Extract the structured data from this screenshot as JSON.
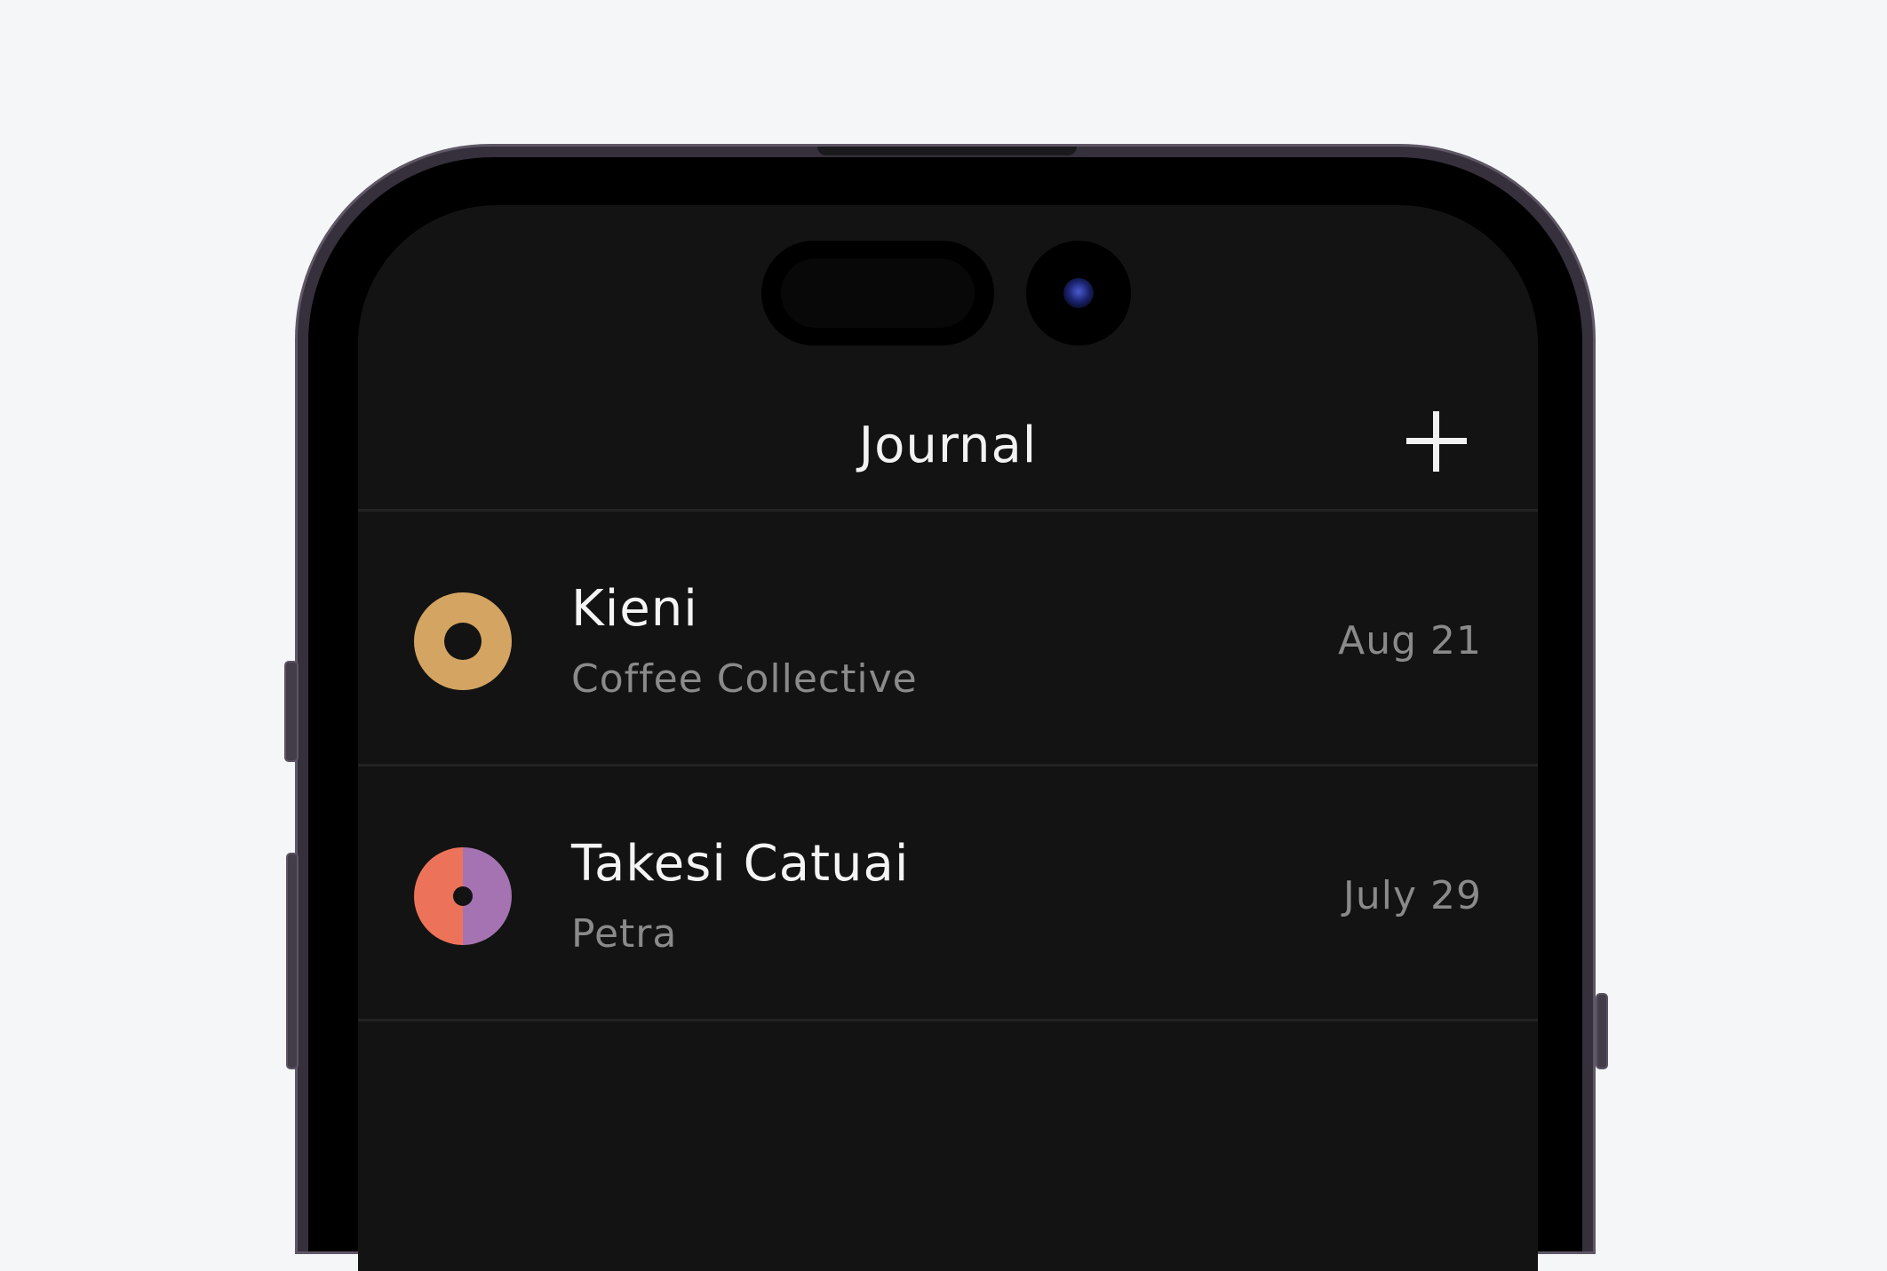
{
  "header": {
    "title": "Journal",
    "add_icon": "plus-icon"
  },
  "entries": [
    {
      "name": "Kieni",
      "subtitle": "Coffee Collective",
      "date": "Aug 21",
      "avatar_icon": "ring-avatar-icon",
      "avatar_colors": [
        "#d4a562"
      ]
    },
    {
      "name": "Takesi Catuai",
      "subtitle": "Petra",
      "date": "July 29",
      "avatar_icon": "split-ring-avatar-icon",
      "avatar_colors": [
        "#ec735a",
        "#a573b2"
      ]
    }
  ],
  "colors": {
    "background": "#f5f6f8",
    "screen": "#131313",
    "primary_text": "#f4f4f4",
    "secondary_text": "#8a8a8a",
    "divider": "#222222"
  }
}
